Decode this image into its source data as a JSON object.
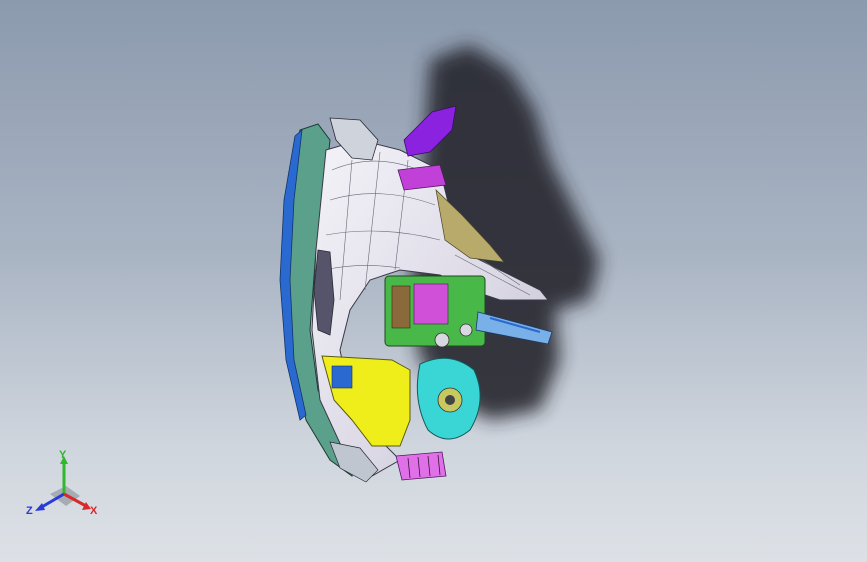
{
  "viewport": {
    "background_top": "#8c9aae",
    "background_bottom": "#dde1e6"
  },
  "model": {
    "description_icon": "cad-assembly-model",
    "colors": {
      "body": "#e8e6f0",
      "rim": "#5aa08a",
      "panel_yellow": "#f0ee1a",
      "part_magenta": "#c040d8",
      "part_purple": "#8a22e0",
      "part_cyan": "#3ad6d6",
      "part_green": "#48b848",
      "part_blue": "#2a6ad0",
      "shadow": "#25282d"
    }
  },
  "triad": {
    "y_label": "Y",
    "z_label": "Z",
    "x_label": "X",
    "y_color": "#2db82d",
    "z_color": "#2a3ad8",
    "x_color": "#d82a2a"
  }
}
